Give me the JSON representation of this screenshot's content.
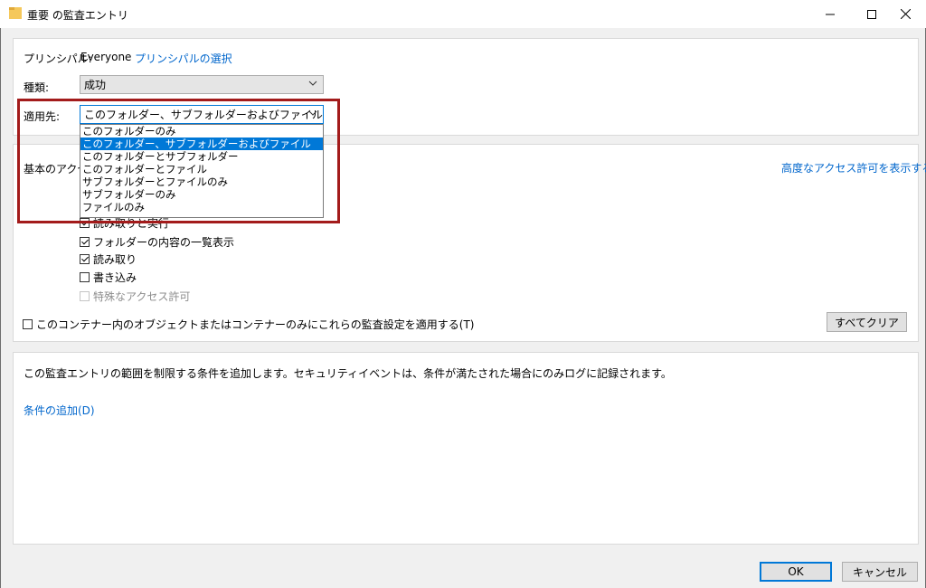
{
  "window": {
    "title": "重要 の監査エントリ",
    "minimize_icon": "minimize-icon",
    "maximize_icon": "maximize-icon",
    "close_icon": "close-icon"
  },
  "principal": {
    "label": "プリンシパル:",
    "value": "Everyone",
    "select_link": "プリンシパルの選択"
  },
  "type": {
    "label": "種類:",
    "value": "成功"
  },
  "applies_to": {
    "label": "適用先:",
    "value": "このフォルダー、サブフォルダーおよびファイル",
    "options": [
      "このフォルダーのみ",
      "このフォルダー、サブフォルダーおよびファイル",
      "このフォルダーとサブフォルダー",
      "このフォルダーとファイル",
      "サブフォルダーとファイルのみ",
      "サブフォルダーのみ",
      "ファイルのみ"
    ],
    "selected_index": 1
  },
  "permissions": {
    "section_label": "基本のアクセ",
    "advanced_link": "高度なアクセス許可を表示する",
    "items": [
      {
        "label": "読み取りと実行",
        "checked": true,
        "disabled": false
      },
      {
        "label": "フォルダーの内容の一覧表示",
        "checked": true,
        "disabled": false
      },
      {
        "label": "読み取り",
        "checked": true,
        "disabled": false
      },
      {
        "label": "書き込み",
        "checked": false,
        "disabled": false
      },
      {
        "label": "特殊なアクセス許可",
        "checked": false,
        "disabled": true
      }
    ],
    "apply_container_only": "このコンテナー内のオブジェクトまたはコンテナーのみにこれらの監査設定を適用する(T)",
    "clear_all": "すべてクリア"
  },
  "conditions": {
    "description": "この監査エントリの範囲を制限する条件を追加します。セキュリティイベントは、条件が満たされた場合にのみログに記録されます。",
    "add_link": "条件の追加(D)"
  },
  "footer": {
    "ok": "OK",
    "cancel": "キャンセル"
  },
  "colors": {
    "highlight": "#a31b1b",
    "accent": "#0078d7",
    "link": "#0066cc"
  }
}
